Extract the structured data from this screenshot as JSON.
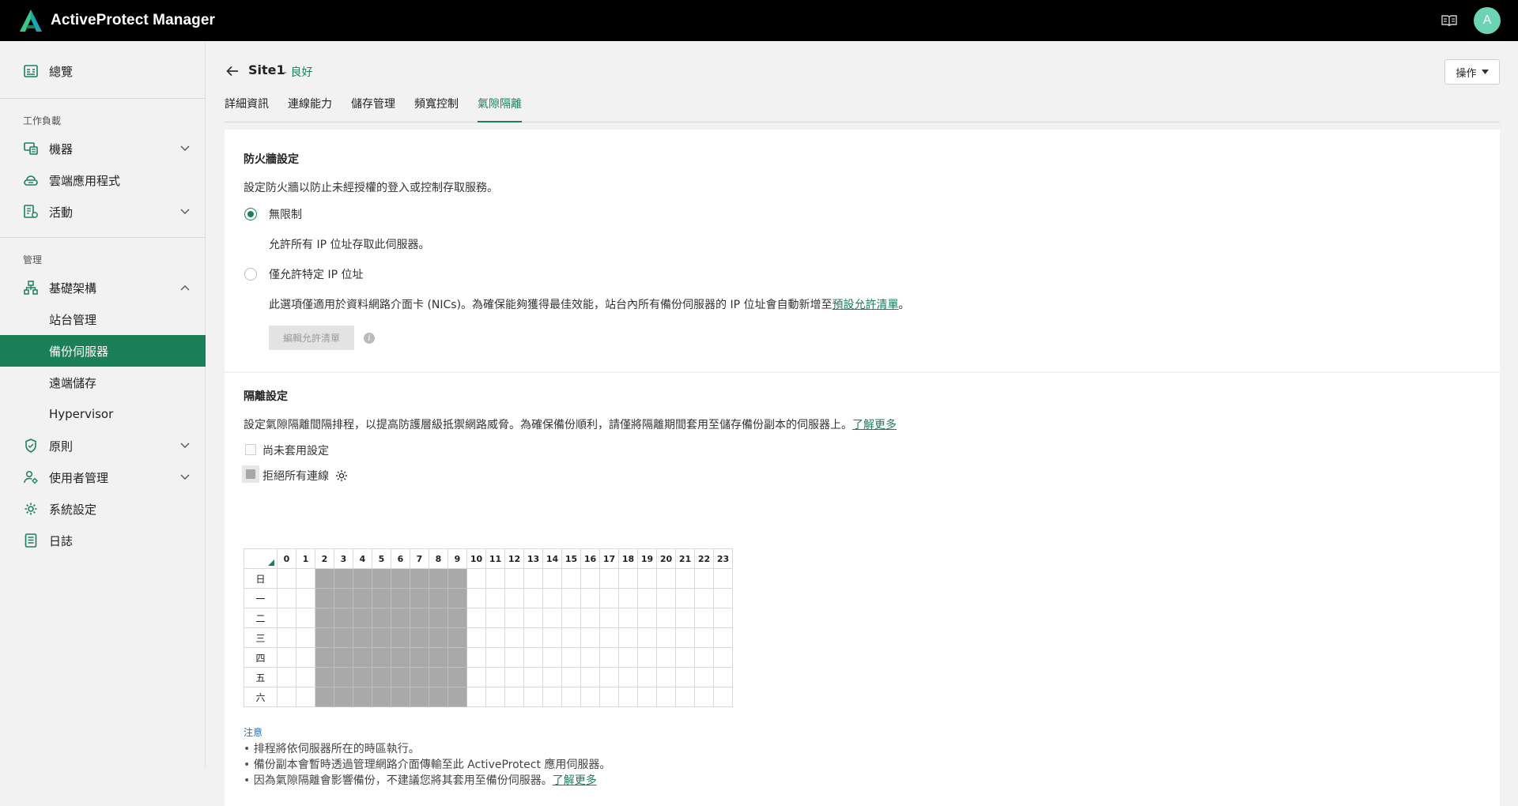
{
  "app": {
    "title": "ActiveProtect Manager",
    "avatar_letter": "A",
    "brand_color": "#1b7f5a"
  },
  "sidebar": {
    "overview": "總覽",
    "section_workloads": "工作負載",
    "machines": "機器",
    "cloud_apps": "雲端應用程式",
    "activities": "活動",
    "section_manage": "管理",
    "infrastructure": "基礎架構",
    "site_management": "站台管理",
    "backup_servers": "備份伺服器",
    "remote_storage": "遠端儲存",
    "hypervisor": "Hypervisor",
    "policies": "原則",
    "user_management": "使用者管理",
    "system_settings": "系統設定",
    "logs": "日誌"
  },
  "header": {
    "site_name": "Site1",
    "site_status": "- 良好",
    "actions_label": "操作"
  },
  "tabs": [
    "詳細資訊",
    "連線能力",
    "儲存管理",
    "頻寬控制",
    "氣隙隔離"
  ],
  "firewall": {
    "title": "防火牆設定",
    "description": "設定防火牆以防止未經授權的登入或控制存取服務。",
    "option_unrestricted": "無限制",
    "option_unrestricted_desc": "允許所有 IP 位址存取此伺服器。",
    "option_specific": "僅允許特定 IP 位址",
    "option_specific_desc_prefix": "此選項僅適用於資料網路介面卡 (NICs)。為確保能夠獲得最佳效能，站台內所有備份伺服器的 IP 位址會自動新增至",
    "option_specific_desc_link": "預設允許清單",
    "option_specific_desc_suffix": "。",
    "edit_allowlist_label": "編輯允許清單"
  },
  "isolation": {
    "title": "隔離設定",
    "description_prefix": "設定氣隙隔離間隔排程，以提高防護層級抵禦網路威脅。為確保備份順利，請僅將隔離期間套用至儲存備份副本的伺服器上。",
    "description_link": "了解更多",
    "legend_not_applied": "尚未套用設定",
    "legend_deny_all": "拒絕所有連線",
    "hours": [
      "0",
      "1",
      "2",
      "3",
      "4",
      "5",
      "6",
      "7",
      "8",
      "9",
      "10",
      "11",
      "12",
      "13",
      "14",
      "15",
      "16",
      "17",
      "18",
      "19",
      "20",
      "21",
      "22",
      "23"
    ],
    "days": [
      "日",
      "一",
      "二",
      "三",
      "四",
      "五",
      "六"
    ],
    "blocked_hours": [
      2,
      3,
      4,
      5,
      6,
      7,
      8,
      9
    ],
    "note_title": "注意",
    "notes": [
      "排程將依伺服器所在的時區執行。",
      "備份副本會暫時透過管理網路介面傳輸至此 ActiveProtect 應用伺服器。",
      "因為氣隙隔離會影響備份，不建議您將其套用至備份伺服器。"
    ],
    "note3_link": "了解更多"
  }
}
